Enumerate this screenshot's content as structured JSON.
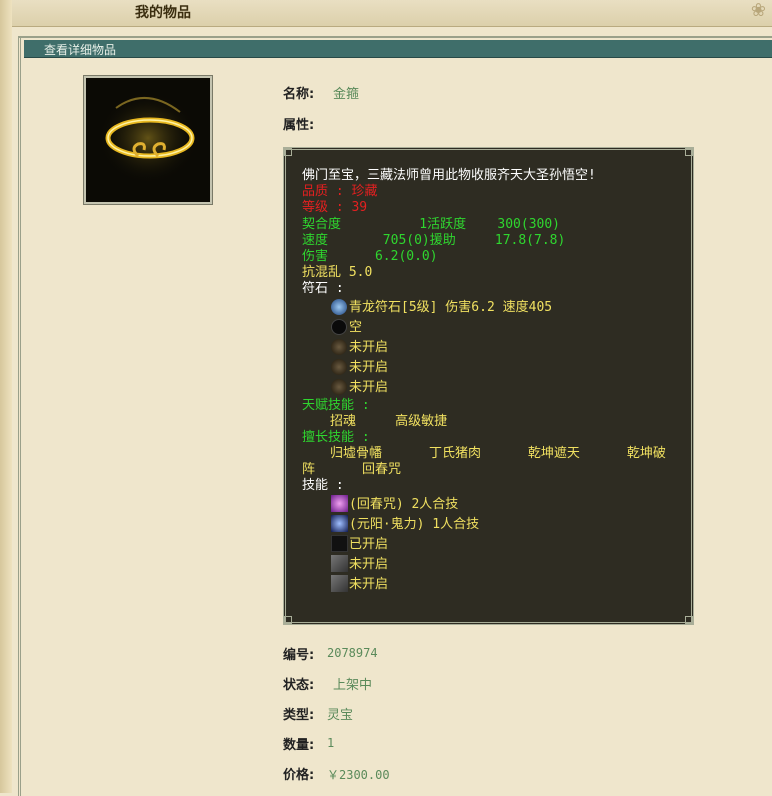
{
  "top": {
    "title": "我的物品"
  },
  "panel": {
    "header": "查看详细物品"
  },
  "item": {
    "name_label": "名称:",
    "name": "金箍",
    "attr_label": "属性:",
    "desc": "佛门至宝，三藏法师曾用此物收服齐天大圣孙悟空!",
    "quality": "品质 : 珍藏",
    "level": "等级 : 39",
    "row_fit": "契合度          1活跃度    300(300)",
    "row_speed": "速度       705(0)援助     17.8(7.8)",
    "row_dmg": "伤害      6.2(0.0)",
    "row_chaos": "抗混乱 5.0",
    "rune_label": "符石 :",
    "runes": [
      "青龙符石[5级] 伤害6.2 速度405",
      "空",
      "未开启",
      "未开启",
      "未开启"
    ],
    "talent_label": "天赋技能 :",
    "talents": "招魂     高级敏捷",
    "expert_label": "擅长技能 :",
    "expert_line1": "归墟骨幡      丁氏猪肉      乾坤遮天      乾坤破",
    "expert_line2": "阵      回春咒",
    "skill_label": "技能 :",
    "skills": [
      "(回春咒) 2人合技",
      "(元阳·鬼力) 1人合技",
      "已开启",
      "未开启",
      "未开启"
    ],
    "id_label": "编号:",
    "id": "2078974",
    "status_label": "状态:",
    "status": "上架中",
    "type_label": "类型:",
    "type": "灵宝",
    "qty_label": "数量:",
    "qty": "1",
    "price_label": "价格:",
    "price": "￥2300.00"
  }
}
